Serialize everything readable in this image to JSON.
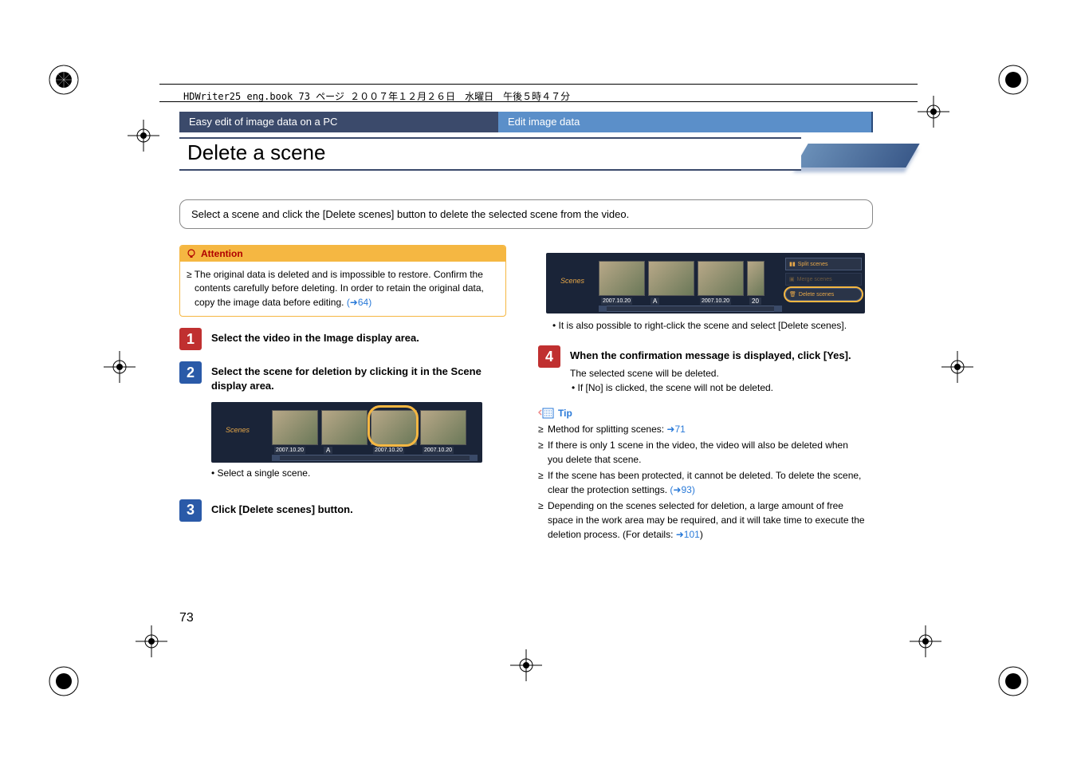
{
  "header_meta": "HDWriter25_eng.book  73 ページ  ２００７年１２月２６日　水曜日　午後５時４７分",
  "tab_left": "Easy edit of image data on a PC",
  "tab_right": "Edit image data",
  "title": "Delete a scene",
  "summary": "Select a scene and click the [Delete scenes] button to delete the selected scene from the video.",
  "attention": {
    "label": "Attention",
    "body": "The original data is deleted and is impossible to restore. Confirm the contents carefully before deleting. In order to retain the original data, copy the image data before editing.",
    "link": "(➜64)"
  },
  "steps": {
    "s1": "Select the video in the Image display area.",
    "s2": "Select the scene for deletion by clicking it in the Scene display area.",
    "s2_sub": "• Select a single scene.",
    "s3": "Click [Delete scenes] button.",
    "s3_sub": "• It is also possible to right-click the scene and select [Delete scenes].",
    "s4": "When the confirmation message is displayed, click [Yes].",
    "s4_sub1": "The selected scene will be deleted.",
    "s4_sub2": "• If [No] is clicked, the scene will not be deleted."
  },
  "scene": {
    "label": "Scenes",
    "dates": [
      "2007.10.20",
      "A",
      "2007.10.20",
      "2007.10.20"
    ],
    "right_dates": [
      "2007.10.20",
      "A",
      "2007.10.20",
      "20"
    ],
    "panel": {
      "split": "Split scenes",
      "merge": "Merge scenes",
      "delete": "Delete scenes"
    }
  },
  "tip": {
    "label": "Tip",
    "items": [
      {
        "text": "Method for splitting scenes: ",
        "link": "➜71"
      },
      {
        "text": "If there is only 1 scene in the video, the video will also be deleted when you delete that scene."
      },
      {
        "text": "If the scene has been protected, it cannot be deleted. To delete the scene, clear the protection settings. ",
        "link": "(➜93)"
      },
      {
        "text": "Depending on the scenes selected for deletion, a large amount of free space in the work area may be required, and it will take time to execute the deletion process. (For details: ",
        "link": "➜101",
        "suffix": ")"
      }
    ]
  },
  "page_number": "73"
}
